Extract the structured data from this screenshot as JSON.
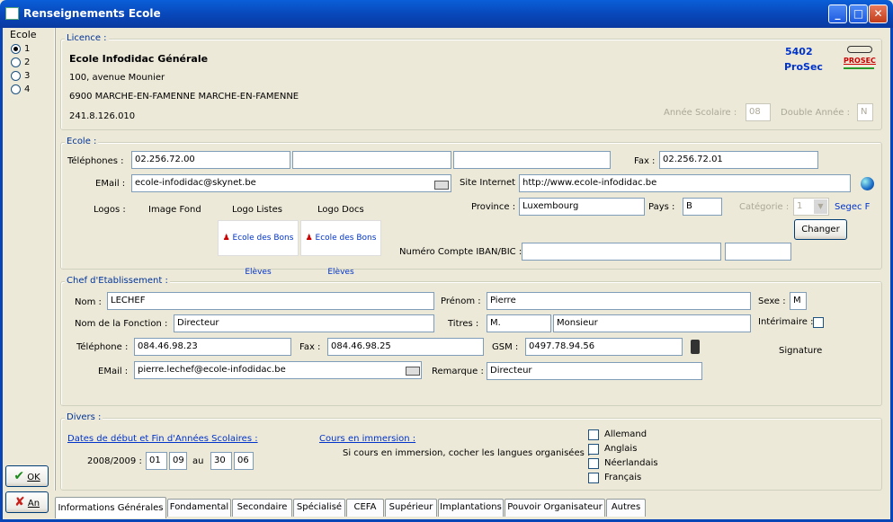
{
  "window": {
    "title": "Renseignements Ecole",
    "minimize": "_",
    "maximize": "□",
    "close": "✕"
  },
  "left": {
    "label": "Ecole",
    "radios": [
      "1",
      "2",
      "3",
      "4"
    ],
    "selected": "1"
  },
  "buttons": {
    "ok": "OK",
    "cancel": "An"
  },
  "licence": {
    "legend": "Licence :",
    "name": "Ecole Infodidac Générale",
    "address": "100, avenue Mounier",
    "city": "6900 MARCHE-EN-FAMENNE MARCHE-EN-FAMENNE",
    "code": "241.8.126.010",
    "number": "5402",
    "brand": "ProSec",
    "logo_text": "PROSEC",
    "annee_label": "Année Scolaire :",
    "annee_value": "08",
    "double_label": "Double Année :",
    "double_value": "N"
  },
  "ecole": {
    "legend": "Ecole :",
    "tel_label": "Téléphones :",
    "tel1": "02.256.72.00",
    "tel2": "",
    "tel3": "",
    "fax_label": "Fax :",
    "fax": "02.256.72.01",
    "email_label": "EMail :",
    "email": "ecole-infodidac@skynet.be",
    "site_label": "Site Internet :",
    "site": "http://www.ecole-infodidac.be",
    "logos_label": "Logos :",
    "image_fond": "Image Fond",
    "logo_listes": "Logo Listes",
    "logo_docs": "Logo Docs",
    "logo_img_text": "Ecole des Bons Elèves",
    "province_label": "Province :",
    "province": "Luxembourg",
    "pays_label": "Pays :",
    "pays": "B",
    "categorie_label": "Catégorie :",
    "categorie": "1",
    "segec": "Segec F",
    "changer": "Changer",
    "iban_label": "Numéro Compte IBAN/BIC :",
    "iban": "",
    "bic": ""
  },
  "chef": {
    "legend": "Chef d'Etablissement :",
    "nom_label": "Nom :",
    "nom": "LECHEF",
    "prenom_label": "Prénom :",
    "prenom": "Pierre",
    "sexe_label": "Sexe :",
    "sexe": "M",
    "fonction_label": "Nom de la Fonction :",
    "fonction": "Directeur",
    "titres_label": "Titres :",
    "titre_court": "M.",
    "titre_long": "Monsieur",
    "interimaire_label": "Intérimaire :",
    "tel_label": "Téléphone :",
    "tel": "084.46.98.23",
    "fax_label": "Fax :",
    "fax": "084.46.98.25",
    "gsm_label": "GSM :",
    "gsm": "0497.78.94.56",
    "signature_label": "Signature",
    "email_label": "EMail :",
    "email": "pierre.lechef@ecole-infodidac.be",
    "remarque_label": "Remarque :",
    "remarque": "Directeur"
  },
  "divers": {
    "legend": "Divers :",
    "dates_link": "Dates de début et Fin d'Années Scolaires :",
    "annees": "2008/2009 :",
    "d1": "01",
    "m1": "09",
    "au": "au",
    "d2": "30",
    "m2": "06",
    "immersion_link": "Cours en immersion :",
    "immersion_text": "Si cours en immersion, cocher les langues organisées :",
    "langues": [
      "Allemand",
      "Anglais",
      "Néerlandais",
      "Français"
    ]
  },
  "tabs": [
    "Informations Générales",
    "Fondamental",
    "Secondaire",
    "Spécialisé",
    "CEFA",
    "Supérieur",
    "Implantations",
    "Pouvoir Organisateur",
    "Autres"
  ],
  "colors": {
    "titlebar": "#0846b8",
    "accent_blue": "#003399",
    "background": "#ece9d8"
  }
}
